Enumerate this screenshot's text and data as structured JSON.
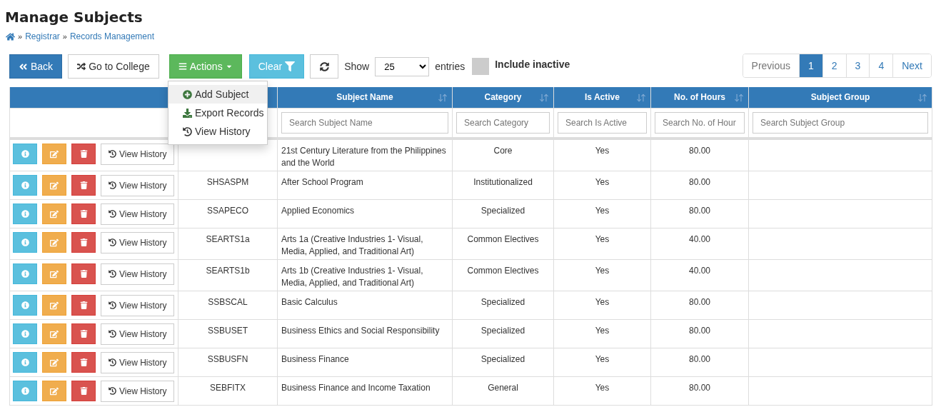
{
  "page": {
    "title": "Manage Subjects",
    "breadcrumb": [
      "Registrar",
      "Records Management"
    ],
    "breadcrumb_separator": "»"
  },
  "toolbar": {
    "back": "Back",
    "go_to_college": "Go to College",
    "actions": "Actions",
    "clear": "Clear",
    "show_label": "Show",
    "page_size": "25",
    "entries_label": "entries",
    "include_inactive": {
      "label": "Include inactive",
      "checked": false
    }
  },
  "actions_menu": [
    {
      "label": "Add Subject",
      "kind": "add",
      "selected": true
    },
    {
      "label": "Export Records",
      "kind": "export",
      "selected": false
    },
    {
      "label": "View History",
      "kind": "history",
      "selected": false
    }
  ],
  "pagination": [
    {
      "label": "Previous",
      "selected": false
    },
    {
      "label": "1",
      "selected": true
    },
    {
      "label": "2",
      "selected": false
    },
    {
      "label": "3",
      "selected": false
    },
    {
      "label": "4",
      "selected": false
    },
    {
      "label": "Next",
      "selected": false
    }
  ],
  "table": {
    "columns": [
      {
        "kind": "blank"
      },
      {
        "kind": "blank"
      },
      {
        "kind": "sortable",
        "label": "Subject Name"
      },
      {
        "kind": "sortable",
        "label": "Category"
      },
      {
        "kind": "sortable",
        "label": "Is Active"
      },
      {
        "kind": "sortable",
        "label": "No. of Hours"
      },
      {
        "kind": "sortable",
        "label": "Subject Group"
      }
    ],
    "filters": [
      {
        "kind": "none"
      },
      {
        "kind": "none"
      },
      {
        "kind": "search",
        "placeholder": "Search Subject Name"
      },
      {
        "kind": "search",
        "placeholder": "Search Category"
      },
      {
        "kind": "search",
        "placeholder": "Search Is Active"
      },
      {
        "kind": "search",
        "placeholder": "Search No. of Hour"
      },
      {
        "kind": "search",
        "placeholder": "Search Subject Group"
      }
    ],
    "rows": [
      {
        "history": "View History",
        "name": "21st Century Literature from the Philippines and the World",
        "category": "Core",
        "active": "Yes",
        "hours": "80.00"
      },
      {
        "history": "View History",
        "code": "SHSASPM",
        "name": "After School Program",
        "category": "Institutionalized",
        "active": "Yes",
        "hours": "80.00"
      },
      {
        "history": "View History",
        "code": "SSAPECO",
        "name": "Applied Economics",
        "category": "Specialized",
        "active": "Yes",
        "hours": "80.00"
      },
      {
        "history": "View History",
        "code": "SEARTS1a",
        "name": "Arts 1a (Creative Industries 1- Visual, Media, Applied, and Traditional Art)",
        "category": "Common Electives",
        "active": "Yes",
        "hours": "40.00"
      },
      {
        "history": "View History",
        "code": "SEARTS1b",
        "name": "Arts 1b (Creative Industries 1- Visual, Media, Applied, and Traditional Art)",
        "category": "Common Electives",
        "active": "Yes",
        "hours": "40.00"
      },
      {
        "history": "View History",
        "code": "SSBSCAL",
        "name": "Basic Calculus",
        "category": "Specialized",
        "active": "Yes",
        "hours": "80.00"
      },
      {
        "history": "View History",
        "code": "SSBUSET",
        "name": "Business Ethics and Social Responsibility",
        "category": "Specialized",
        "active": "Yes",
        "hours": "80.00"
      },
      {
        "history": "View History",
        "code": "SSBUSFN",
        "name": "Business Finance",
        "category": "Specialized",
        "active": "Yes",
        "hours": "80.00"
      },
      {
        "history": "View History",
        "code": "SEBFITX",
        "name": "Business Finance and Income Taxation",
        "category": "General",
        "active": "Yes",
        "hours": "80.00"
      }
    ]
  }
}
